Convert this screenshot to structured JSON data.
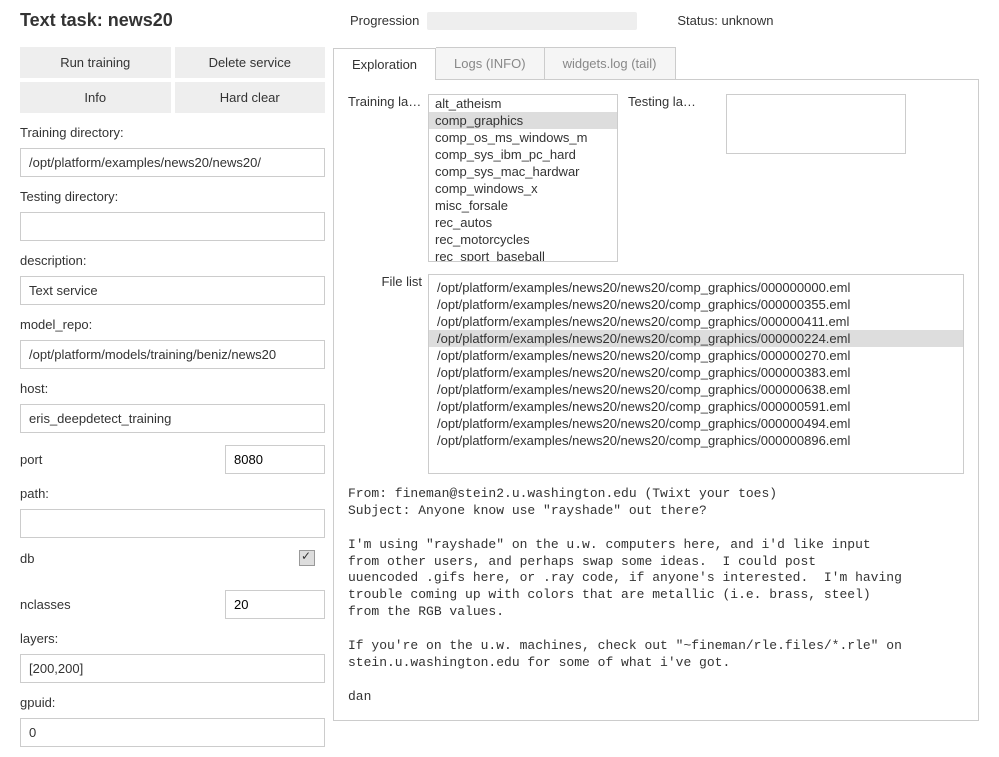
{
  "header": {
    "title": "Text task: news20",
    "progression_label": "Progression",
    "status_label": "Status:",
    "status_value": "unknown"
  },
  "buttons": {
    "run_training": "Run training",
    "delete_service": "Delete service",
    "info": "Info",
    "hard_clear": "Hard clear"
  },
  "fields": {
    "training_dir_label": "Training directory:",
    "training_dir_value": "/opt/platform/examples/news20/news20/",
    "testing_dir_label": "Testing directory:",
    "testing_dir_value": "",
    "description_label": "description:",
    "description_value": "Text service",
    "model_repo_label": "model_repo:",
    "model_repo_value": "/opt/platform/models/training/beniz/news20",
    "host_label": "host:",
    "host_value": "eris_deepdetect_training",
    "port_label": "port",
    "port_value": "8080",
    "path_label": "path:",
    "path_value": "",
    "db_label": "db",
    "nclasses_label": "nclasses",
    "nclasses_value": "20",
    "layers_label": "layers:",
    "layers_value": "[200,200]",
    "gpuid_label": "gpuid:",
    "gpuid_value": "0"
  },
  "tabs": {
    "exploration": "Exploration",
    "logs": "Logs (INFO)",
    "widgets": "widgets.log (tail)"
  },
  "exploration": {
    "training_labels_label": "Training la…",
    "file_list_label": "File list",
    "testing_labels_label": "Testing labels",
    "training_labels": [
      "alt_atheism",
      "comp_graphics",
      "comp_os_ms_windows_m",
      "comp_sys_ibm_pc_hard",
      "comp_sys_mac_hardwar",
      "comp_windows_x",
      "misc_forsale",
      "rec_autos",
      "rec_motorcycles",
      "rec_sport_baseball"
    ],
    "training_labels_selected": 1,
    "file_list": [
      "/opt/platform/examples/news20/news20/comp_graphics/000000000.eml",
      "/opt/platform/examples/news20/news20/comp_graphics/000000355.eml",
      "/opt/platform/examples/news20/news20/comp_graphics/000000411.eml",
      "/opt/platform/examples/news20/news20/comp_graphics/000000224.eml",
      "/opt/platform/examples/news20/news20/comp_graphics/000000270.eml",
      "/opt/platform/examples/news20/news20/comp_graphics/000000383.eml",
      "/opt/platform/examples/news20/news20/comp_graphics/000000638.eml",
      "/opt/platform/examples/news20/news20/comp_graphics/000000591.eml",
      "/opt/platform/examples/news20/news20/comp_graphics/000000494.eml",
      "/opt/platform/examples/news20/news20/comp_graphics/000000896.eml"
    ],
    "file_list_selected": 3,
    "file_content": "From: fineman@stein2.u.washington.edu (Twixt your toes)\nSubject: Anyone know use \"rayshade\" out there?\n\nI'm using \"rayshade\" on the u.w. computers here, and i'd like input\nfrom other users, and perhaps swap some ideas.  I could post\nuuencoded .gifs here, or .ray code, if anyone's interested.  I'm having\ntrouble coming up with colors that are metallic (i.e. brass, steel)\nfrom the RGB values.\n\nIf you're on the u.w. machines, check out \"~fineman/rle.files/*.rle\" on\nstein.u.washington.edu for some of what i've got.\n\ndan"
  }
}
